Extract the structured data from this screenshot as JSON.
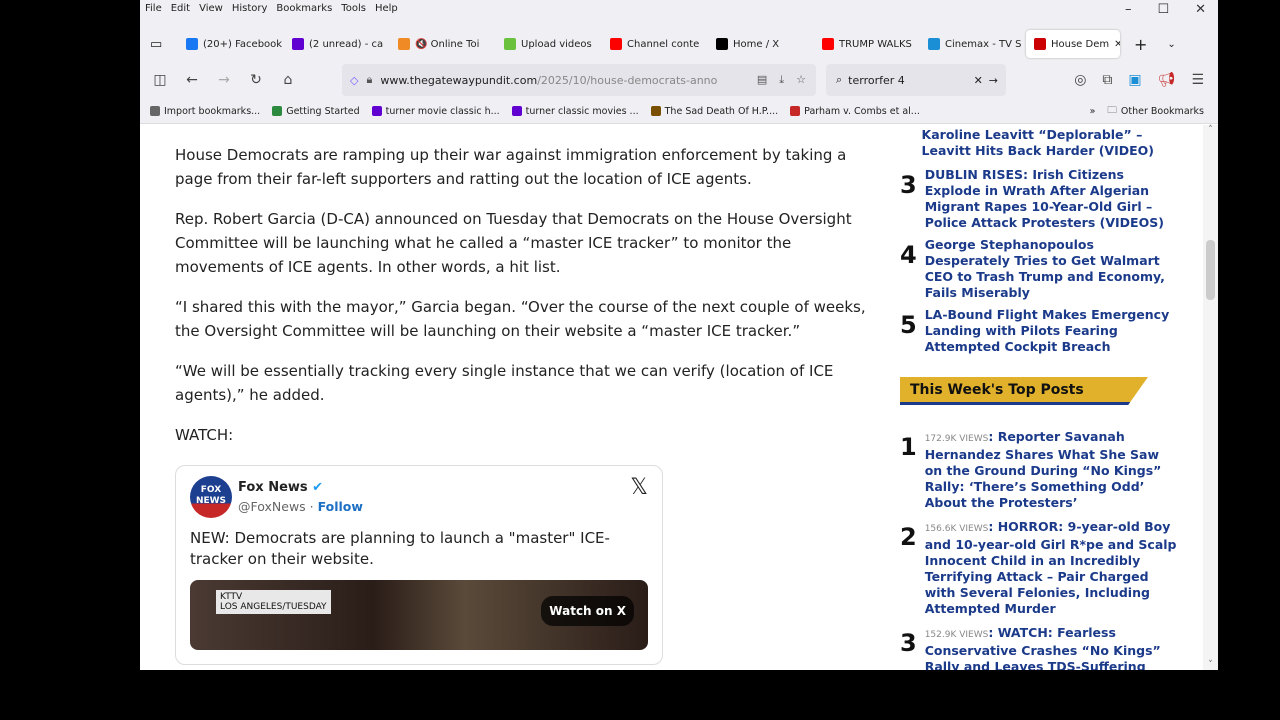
{
  "menu": [
    "File",
    "Edit",
    "View",
    "History",
    "Bookmarks",
    "Tools",
    "Help"
  ],
  "tabs": [
    {
      "label": "(20+) Facebook",
      "color": "#1877f2"
    },
    {
      "label": "(2 unread) - ca",
      "color": "#6001d2"
    },
    {
      "label": "🔇 Online Toi",
      "color": "#f08a24"
    },
    {
      "label": "Upload videos",
      "color": "#6ac13b"
    },
    {
      "label": "Channel conte",
      "color": "#f00"
    },
    {
      "label": "Home / X",
      "color": "#000"
    },
    {
      "label": "TRUMP WALKS",
      "color": "#f00"
    },
    {
      "label": "Cinemax - TV S",
      "color": "#1a8fd6"
    },
    {
      "label": "House Dem",
      "color": "#c00"
    }
  ],
  "url": {
    "domain": "www.thegatewaypundit.com",
    "path": "/2025/10/house-democrats-anno"
  },
  "search": "terrorfer 4",
  "bookmarks": [
    {
      "label": "Import bookmarks...",
      "color": "#666"
    },
    {
      "label": "Getting Started",
      "color": "#2b8a3e"
    },
    {
      "label": "turner movie classic h...",
      "color": "#6001d2"
    },
    {
      "label": "turner classic movies ...",
      "color": "#6001d2"
    },
    {
      "label": "The Sad Death Of H.P....",
      "color": "#7a4f00"
    },
    {
      "label": "Parham v. Combs et al...",
      "color": "#c62828"
    }
  ],
  "other_bookmarks": "Other Bookmarks",
  "article": {
    "paragraphs": [
      "House Democrats are ramping up their war against immigration enforcement by taking a page from their far-left supporters and ratting out the location of ICE agents.",
      "Rep. Robert Garcia (D-CA) announced on Tuesday that Democrats on the House Oversight Committee will be launching what he called a “master ICE tracker” to monitor the movements of ICE agents. In other words, a hit list.",
      "“I shared this with the mayor,” Garcia began. “Over the course of the next couple of weeks, the Oversight Committee will be launching on their website a “master ICE tracker.”",
      "“We will be essentially tracking every single instance that we can verify (location of ICE agents),” he added.",
      "WATCH:"
    ],
    "tweet": {
      "name": "Fox News",
      "handle": "@FoxNews",
      "follow": "Follow",
      "text": "NEW: Democrats are planning to launch a \"master\" ICE-tracker on their website.",
      "chyron1": "KTTV",
      "chyron2": "LOS ANGELES/TUESDAY",
      "watch": "Watch on X",
      "logo": "FOX NEWS"
    }
  },
  "sidebar": {
    "top_partial": "Karoline Leavitt “Deplorable” – Leavitt Hits Back Harder (VIDEO)",
    "trending": [
      {
        "n": "3",
        "title": "DUBLIN RISES: Irish Citizens Explode in Wrath After Algerian Migrant Rapes 10-Year-Old Girl – Police Attack Protesters (VIDEOS)"
      },
      {
        "n": "4",
        "title": "George Stephanopoulos Desperately Tries to Get Walmart CEO to Trash Trump and Economy, Fails Miserably"
      },
      {
        "n": "5",
        "title": "LA-Bound Flight Makes Emergency Landing with Pilots Fearing Attempted Cockpit Breach"
      }
    ],
    "week_heading": "This Week's Top Posts",
    "week": [
      {
        "n": "1",
        "views": "172.9K VIEWS",
        "title": "Reporter Savanah Hernandez Shares What She Saw on the Ground During “No Kings” Rally: ‘There’s Something Odd’ About the Protesters’"
      },
      {
        "n": "2",
        "views": "156.6K VIEWS",
        "title": "HORROR: 9-year-old Boy and 10-year-old Girl R*pe and Scalp Innocent Child in an Incredibly Terrifying Attack – Pair Charged with Several Felonies, Including Attempted Murder"
      },
      {
        "n": "3",
        "views": "152.9K VIEWS",
        "title": "WATCH: Fearless Conservative Crashes “No Kings” Rally and Leaves TDS-Suffering"
      }
    ]
  }
}
